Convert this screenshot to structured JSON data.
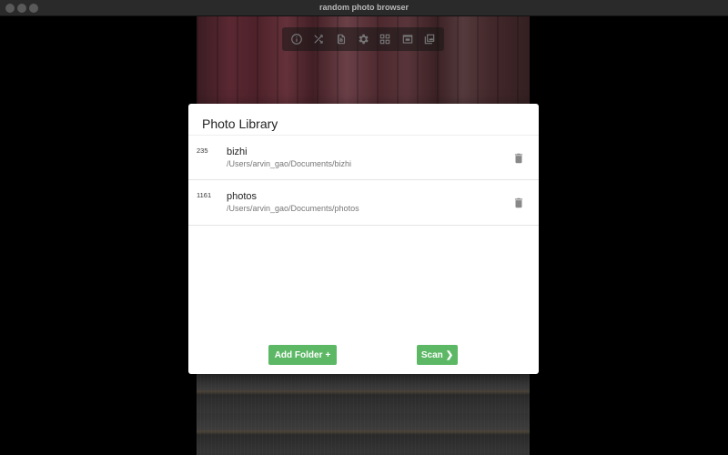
{
  "window": {
    "title": "random photo browser"
  },
  "toolbar": {
    "icons": [
      "info-icon",
      "shuffle-icon",
      "rotate-icon",
      "gear-icon",
      "grid-icon",
      "window-icon",
      "gallery-icon"
    ]
  },
  "dialog": {
    "title": "Photo Library",
    "libraries": [
      {
        "count": "235",
        "name": "bizhi",
        "path": "/Users/arvin_gao/Documents/bizhi"
      },
      {
        "count": "1161",
        "name": "photos",
        "path": "/Users/arvin_gao/Documents/photos"
      }
    ],
    "add_folder_label": "Add Folder",
    "add_folder_icon": "+",
    "scan_label": "Scan",
    "scan_icon": "❯"
  },
  "colors": {
    "accent": "#5db866",
    "dialog_bg": "#ffffff"
  }
}
